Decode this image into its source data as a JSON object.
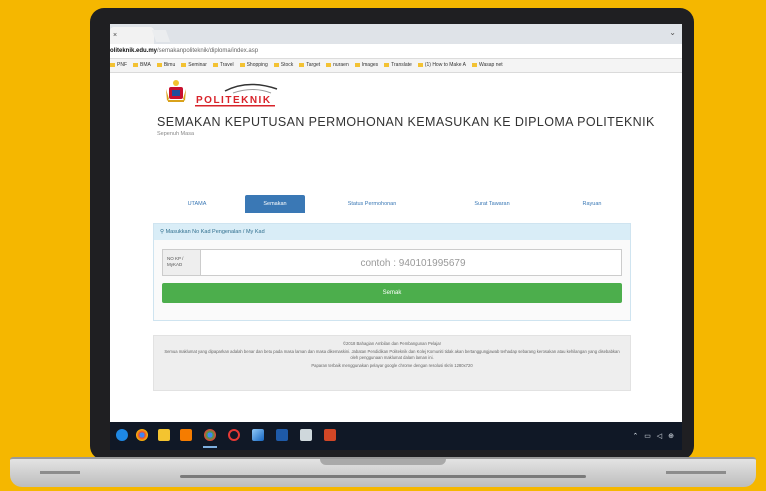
{
  "browser": {
    "tab_label": "×",
    "url_domain": "oliteknik.edu.my",
    "url_path": "/semakanpoliteknik/diploma/index.asp",
    "bookmarks": [
      "PNF",
      "BMA",
      "Bimu",
      "Seminar",
      "Travel",
      "Shopping",
      "Stock",
      "Target",
      "nuraen",
      "Images",
      "Translate",
      "(1) How to Make A",
      "Wasap net"
    ]
  },
  "header": {
    "title": "SEMAKAN KEPUTUSAN PERMOHONAN KEMASUKAN KE DIPLOMA POLITEKNIK",
    "subtitle": "Sepenuh Masa",
    "logo_text": "POLITEKNIK"
  },
  "nav_tabs": [
    {
      "label": "UTAMA",
      "active": false
    },
    {
      "label": "Semakan",
      "active": true
    },
    {
      "label": "Status Permohonan",
      "active": false
    },
    {
      "label": "Surat Tawaran",
      "active": false
    },
    {
      "label": "Rayuan",
      "active": false
    }
  ],
  "form": {
    "panel_heading": "Masukkan No Kad Pengenalan / My Kad",
    "addon_line1": "NO KP /",
    "addon_line2": "MyKAD",
    "ic_placeholder": "contoh : 940101995679",
    "submit_label": "Semak"
  },
  "footer": {
    "line1": "©2018 Bahagian Ambilan dan Pembangunan Pelajar",
    "line2": "Semua maklumat yang dipaparkan adalah benar dan betu pada masa laman dan masa dikemaskini. Jabatan Pendidikan Politeknik dan Kolej Komuniti tidak akan bertanggungjawab terhadap sebarang kerosakan atau kehilangan yang disebabkan oleh penggunaan maklumat dalam laman ini.",
    "line3": "Paparan terbaik menggunakan pelayar google chrome dengan resolusi skrin 1280x720"
  },
  "colors": {
    "brand_red": "#d8232a",
    "tab_blue": "#3a78b5",
    "success_green": "#4cae4c",
    "panel_info": "#d9edf7",
    "background_yellow": "#f5b700"
  },
  "taskbar": {
    "icons": [
      "edge-icon",
      "chrome-icon",
      "explorer-icon",
      "store-icon",
      "chrome-active-icon",
      "opera-icon",
      "paint-icon",
      "word-icon",
      "photos-icon",
      "powerpoint-icon"
    ]
  }
}
